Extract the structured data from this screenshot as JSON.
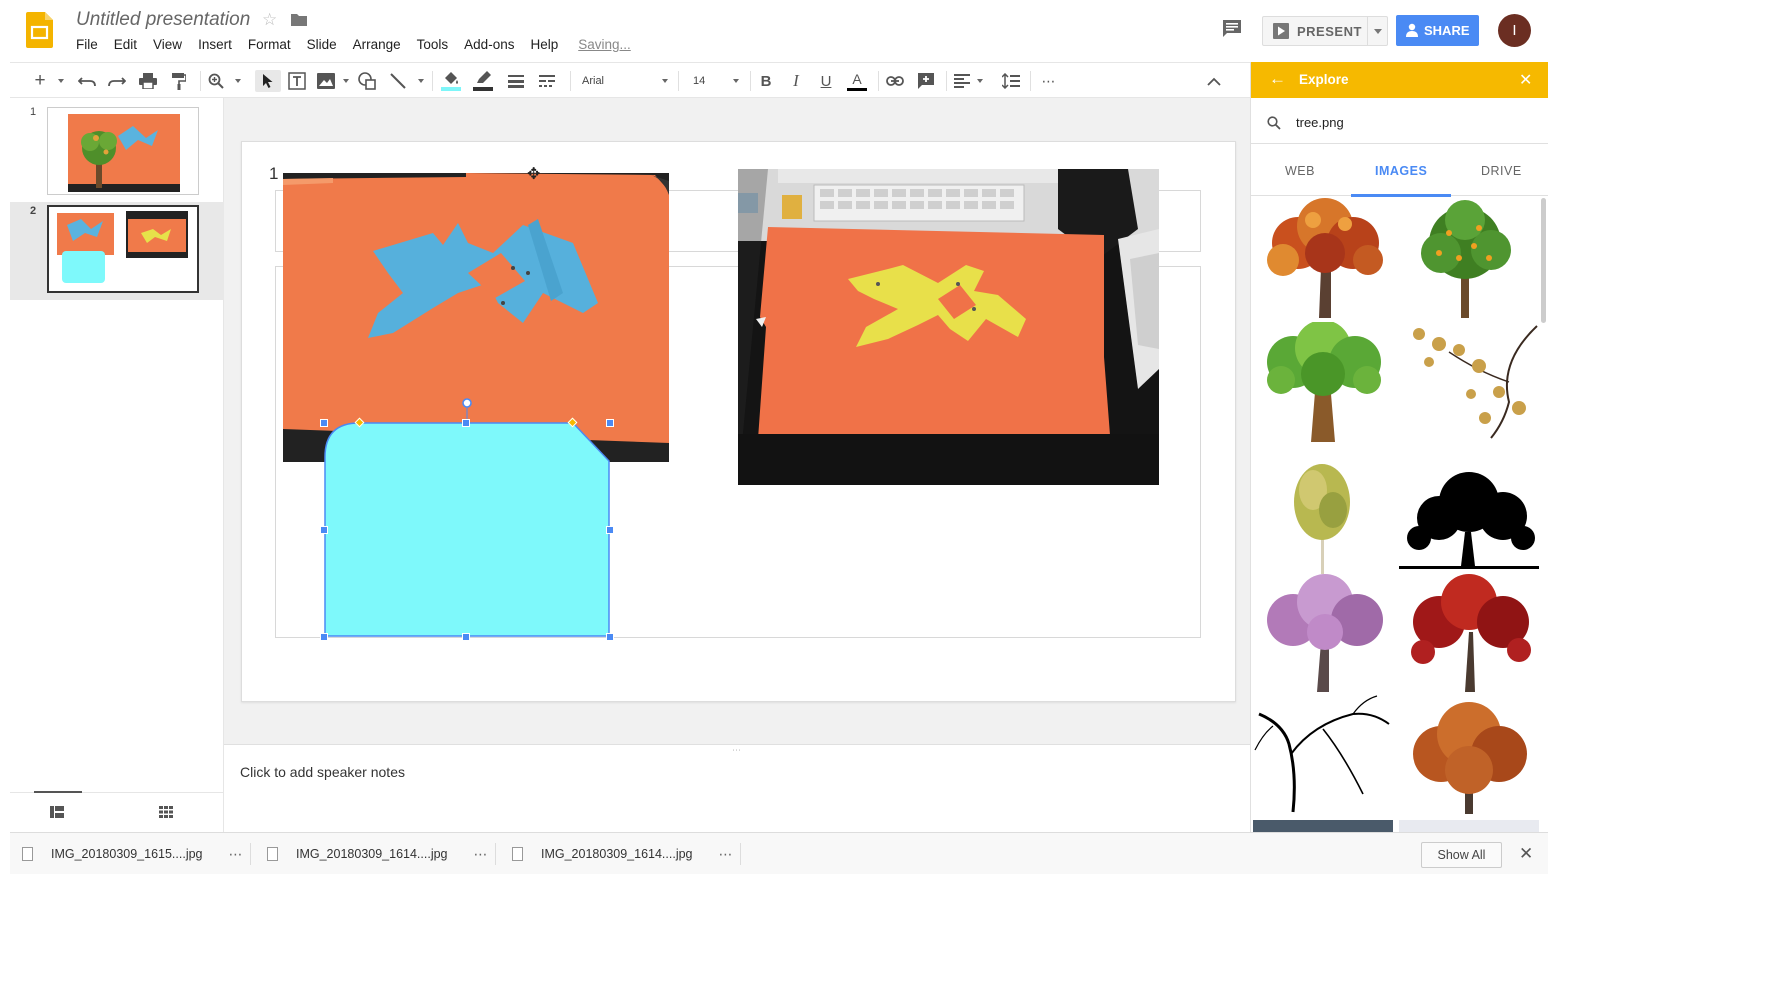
{
  "header": {
    "title": "Untitled presentation",
    "menu": [
      "File",
      "Edit",
      "View",
      "Insert",
      "Format",
      "Slide",
      "Arrange",
      "Tools",
      "Add-ons",
      "Help"
    ],
    "saving_status": "Saving...",
    "present_label": "PRESENT",
    "share_label": "SHARE",
    "avatar_initial": "I"
  },
  "toolbar": {
    "font_name": "Arial",
    "font_size": "14",
    "fill_color": "#7ef6f9",
    "text_color": "#000000"
  },
  "filmstrip": {
    "slides": [
      {
        "number": "1"
      },
      {
        "number": "2",
        "active": true
      }
    ]
  },
  "slide": {
    "number_text": "1",
    "shape_color": "#7ef9fb",
    "paper_color": "#f07a4a"
  },
  "notes": {
    "placeholder": "Click to add speaker notes"
  },
  "explore": {
    "title": "Explore",
    "search_query": "tree.png",
    "tabs": [
      {
        "label": "WEB",
        "active": false
      },
      {
        "label": "IMAGES",
        "active": true
      },
      {
        "label": "DRIVE",
        "active": false
      }
    ],
    "accent": "#f6b900"
  },
  "downloads": {
    "items": [
      {
        "name": "IMG_20180309_1615....jpg"
      },
      {
        "name": "IMG_20180309_1614....jpg"
      },
      {
        "name": "IMG_20180309_1614....jpg"
      }
    ],
    "show_all_label": "Show All"
  }
}
